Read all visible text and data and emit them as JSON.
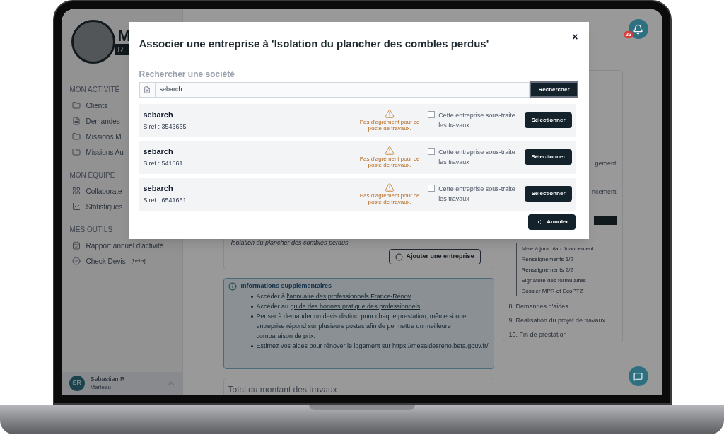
{
  "sidebar": {
    "logo_letter": "M",
    "logo_sub": "R",
    "sections": [
      {
        "title": "MON ACTIVITÉ",
        "items": [
          {
            "label": "Clients",
            "kind": "folder"
          },
          {
            "label": "Demandes",
            "kind": "file"
          },
          {
            "label": "Missions M",
            "kind": "folder"
          },
          {
            "label": "Missions Au",
            "kind": "folder"
          }
        ]
      },
      {
        "title": "MON ÉQUIPE",
        "items": [
          {
            "label": "Collaborate",
            "kind": "grid"
          },
          {
            "label": "Statistiques",
            "kind": "chart"
          }
        ]
      },
      {
        "title": "MES OUTILS",
        "items": [
          {
            "label": "Rapport annuel d'activité",
            "kind": "calendar"
          },
          {
            "label": "Check Devis",
            "badge": "[beta]",
            "kind": "check"
          }
        ]
      }
    ],
    "user": {
      "initials": "SR",
      "name": "Sebastian R",
      "role": "Marteau"
    }
  },
  "notifications": {
    "count": "23"
  },
  "main": {
    "work_item": "Isolation du plancher des combles perdus",
    "add_button": "Ajouter une entreprise",
    "info": {
      "title": "Informations supplémentaires",
      "bullets": [
        {
          "before": "Accéder à ",
          "link": "l'annuaire des professionnels France-Rénov",
          "after": "."
        },
        {
          "before": "Accéder au ",
          "link": "guide des bonnes pratique des professionnels",
          "after": "."
        },
        {
          "before": "Penser à demander un devis distinct pour chaque prestation, même si une entreprise répond sur plusieurs postes afin de permettre un meilleure comparaison de prix."
        },
        {
          "before": "Estimez vos aides pour rénover le logement sur",
          "link": "https://mesaidesreno.beta.gouv.fr/"
        }
      ]
    },
    "total_title": "Total du montant des travaux"
  },
  "steps_panel": {
    "fragments": [
      "gement",
      "ncement"
    ],
    "substeps": [
      "Mise à jour plan financement",
      "Renseignements 1/2",
      "Renseignements 2/2",
      "Signature des formulaires",
      "Dossier MPR et EcoPTZ"
    ],
    "steps": [
      "8. Demandes d'aides",
      "9. Réalisation du projet de travaux",
      "10. Fin de prestation"
    ]
  },
  "modal": {
    "title": "Associer une entreprise à 'Isolation du plancher des combles perdus'",
    "close": "×",
    "search_label": "Rechercher une société",
    "search_value": "sebarch",
    "search_button": "Rechercher",
    "results": [
      {
        "name": "sebarch",
        "siret": "Siret : 3543665",
        "warning": "Pas d'agrément pour ce poste de travaux.",
        "subcontract_label": "Cette entreprise sous-traite les travaux",
        "checked": false,
        "button": "Sélectionner"
      },
      {
        "name": "sebarch",
        "siret": "Siret : 541861",
        "warning": "Pas d'agrément pour ce poste de travaux.",
        "subcontract_label": "Cette entreprise sous-traite les travaux",
        "checked": false,
        "button": "Sélectionner"
      },
      {
        "name": "sebarch",
        "siret": "Siret : 6541651",
        "warning": "Pas d'agrément pour ce poste de travaux.",
        "subcontract_label": "Cette entreprise sous-traite les travaux",
        "checked": false,
        "button": "Sélectionner"
      }
    ],
    "cancel": "Annuler"
  }
}
